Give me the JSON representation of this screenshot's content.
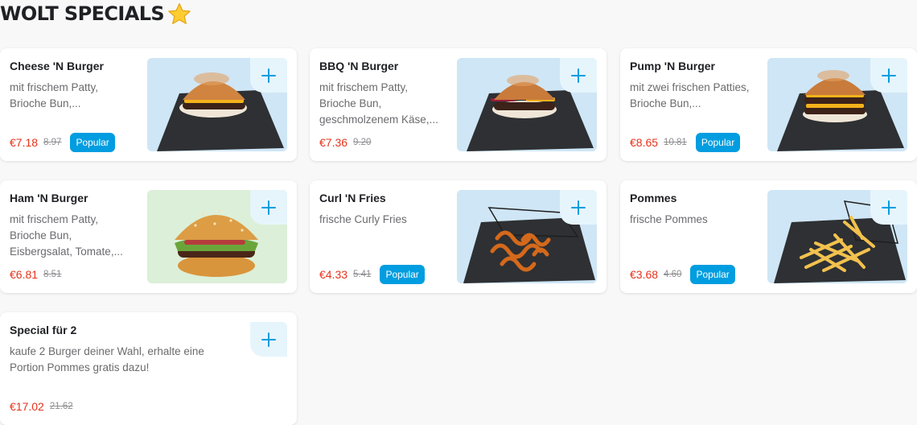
{
  "section": {
    "title": "WOLT SPECIALS",
    "title_icon": "star-emoji"
  },
  "colors": {
    "price": "#e5331b",
    "badge": "#009de0",
    "add_button_bg": "#e6f5fc",
    "add_icon": "#009de0"
  },
  "items": [
    {
      "name": "Cheese 'N Burger",
      "description": "mit frischem Patty, Brioche Bun,...",
      "price": "€7.18",
      "old_price": "8.97",
      "badge": "Popular",
      "image": "cheeseburger-on-slate"
    },
    {
      "name": "BBQ 'N Burger",
      "description": "mit frischem Patty, Brioche Bun, geschmolzenem Käse,...",
      "price": "€7.36",
      "old_price": "9.20",
      "badge": "",
      "image": "bbq-burger-on-slate"
    },
    {
      "name": "Pump 'N Burger",
      "description": "mit zwei frischen Patties, Brioche Bun,...",
      "price": "€8.65",
      "old_price": "10.81",
      "badge": "Popular",
      "image": "double-burger-on-slate"
    },
    {
      "name": "Ham 'N Burger",
      "description": "mit frischem Patty, Brioche Bun, Eisbergsalat, Tomate,...",
      "price": "€6.81",
      "old_price": "8.51",
      "badge": "",
      "image": "hamburger-sesame-bun"
    },
    {
      "name": "Curl 'N Fries",
      "description": "frische Curly Fries",
      "price": "€4.33",
      "old_price": "5.41",
      "badge": "Popular",
      "image": "curly-fries-on-slate"
    },
    {
      "name": "Pommes",
      "description": "frische Pommes",
      "price": "€3.68",
      "old_price": "4.60",
      "badge": "Popular",
      "image": "french-fries-on-slate"
    },
    {
      "name": "Special für 2",
      "description": "kaufe 2 Burger deiner Wahl, erhalte eine Portion Pommes gratis dazu!",
      "price": "€17.02",
      "old_price": "21.62",
      "badge": "",
      "image": ""
    }
  ]
}
